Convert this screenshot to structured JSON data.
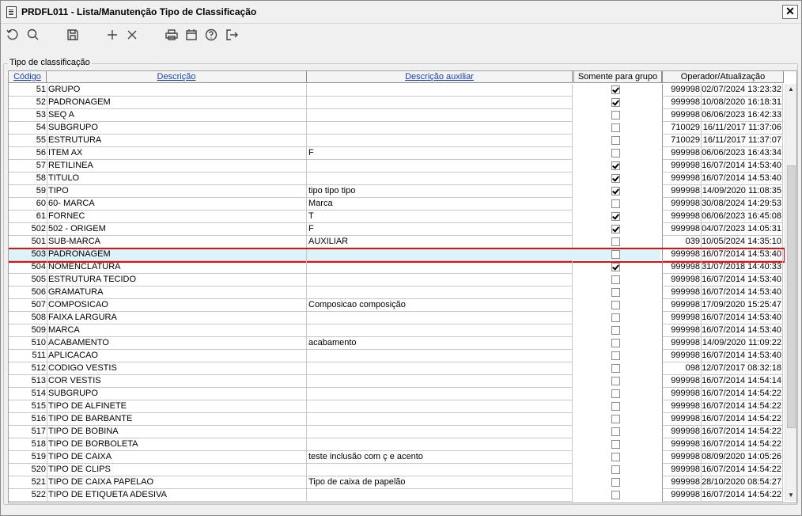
{
  "window": {
    "title": "PRDFL011 - Lista/Manutenção Tipo de Classificação",
    "close_label": "✕"
  },
  "toolbar": {
    "buttons": [
      {
        "icon": "refresh-icon",
        "label": "Atualizar"
      },
      {
        "icon": "search-icon",
        "label": "Pesquisar"
      },
      {
        "icon": "save-icon",
        "label": "Salvar"
      },
      {
        "icon": "plus-icon",
        "label": "Incluir"
      },
      {
        "icon": "close-icon",
        "label": "Excluir"
      },
      {
        "icon": "print-icon",
        "label": "Imprimir"
      },
      {
        "icon": "calendar-icon",
        "label": "Calendário"
      },
      {
        "icon": "help-icon",
        "label": "Ajuda"
      },
      {
        "icon": "exit-icon",
        "label": "Sair"
      }
    ]
  },
  "group": {
    "label": "Tipo de classificação"
  },
  "table": {
    "columns": {
      "codigo": "Código",
      "descricao": "Descrição",
      "descricao_auxiliar": "Descrição auxiliar",
      "somente_grupo": "Somente para grupo",
      "operador_atualizacao": "Operador/Atualização"
    },
    "selected_row_index": 15,
    "rows": [
      {
        "code": "51",
        "desc": "GRUPO",
        "aux": "",
        "group": true,
        "op": "999998",
        "upd": "02/07/2024 13:23:32"
      },
      {
        "code": "52",
        "desc": "PADRONAGEM",
        "aux": "",
        "group": true,
        "op": "999998",
        "upd": "10/08/2020 16:18:31"
      },
      {
        "code": "53",
        "desc": "SEQ A",
        "aux": "",
        "group": false,
        "op": "999998",
        "upd": "06/06/2023 16:42:33"
      },
      {
        "code": "54",
        "desc": "SUBGRUPO",
        "aux": "",
        "group": false,
        "op": "710029",
        "upd": "16/11/2017 11:37:06"
      },
      {
        "code": "55",
        "desc": "ESTRUTURA",
        "aux": "",
        "group": false,
        "op": "710029",
        "upd": "16/11/2017 11:37:07"
      },
      {
        "code": "56",
        "desc": "ITEM AX",
        "aux": "F",
        "group": false,
        "op": "999998",
        "upd": "06/06/2023 16:43:34"
      },
      {
        "code": "57",
        "desc": "RETILINEA",
        "aux": "",
        "group": true,
        "op": "999998",
        "upd": "16/07/2014 14:53:40"
      },
      {
        "code": "58",
        "desc": "TITULO",
        "aux": "",
        "group": true,
        "op": "999998",
        "upd": "16/07/2014 14:53:40"
      },
      {
        "code": "59",
        "desc": "TIPO",
        "aux": "tipo tipo tipo",
        "group": true,
        "op": "999998",
        "upd": "14/09/2020 11:08:35"
      },
      {
        "code": "60",
        "desc": "60- MARCA",
        "aux": "Marca",
        "group": false,
        "op": "999998",
        "upd": "30/08/2024 14:29:53"
      },
      {
        "code": "61",
        "desc": "FORNEC",
        "aux": "T",
        "group": true,
        "op": "999998",
        "upd": "06/06/2023 16:45:08"
      },
      {
        "code": "502",
        "desc": "502 - ORIGEM",
        "aux": "F",
        "group": true,
        "op": "999998",
        "upd": "04/07/2023 14:05:31"
      },
      {
        "code": "501",
        "desc": "SUB-MARCA",
        "aux": "AUXILIAR",
        "group": false,
        "op": "039",
        "upd": "10/05/2024 14:35:10"
      },
      {
        "code": "503",
        "desc": "PADRONAGEM",
        "aux": "",
        "group": false,
        "op": "999998",
        "upd": "16/07/2014 14:53:40"
      },
      {
        "code": "504",
        "desc": "NOMENCLATURA",
        "aux": "",
        "group": true,
        "op": "999998",
        "upd": "31/07/2018 14:40:33"
      },
      {
        "code": "505",
        "desc": "ESTRUTURA TECIDO",
        "aux": "",
        "group": false,
        "op": "999998",
        "upd": "16/07/2014 14:53:40"
      },
      {
        "code": "506",
        "desc": "GRAMATURA",
        "aux": "",
        "group": false,
        "op": "999998",
        "upd": "16/07/2014 14:53:40"
      },
      {
        "code": "507",
        "desc": "COMPOSICAO",
        "aux": "Composicao composição",
        "group": false,
        "op": "999998",
        "upd": "17/09/2020 15:25:47"
      },
      {
        "code": "508",
        "desc": "FAIXA LARGURA",
        "aux": "",
        "group": false,
        "op": "999998",
        "upd": "16/07/2014 14:53:40"
      },
      {
        "code": "509",
        "desc": "MARCA",
        "aux": "",
        "group": false,
        "op": "999998",
        "upd": "16/07/2014 14:53:40"
      },
      {
        "code": "510",
        "desc": "ACABAMENTO",
        "aux": "acabamento",
        "group": false,
        "op": "999998",
        "upd": "14/09/2020 11:09:22"
      },
      {
        "code": "511",
        "desc": "APLICACAO",
        "aux": "",
        "group": false,
        "op": "999998",
        "upd": "16/07/2014 14:53:40"
      },
      {
        "code": "512",
        "desc": "CODIGO VESTIS",
        "aux": "",
        "group": false,
        "op": "098",
        "upd": "12/07/2017 08:32:18"
      },
      {
        "code": "513",
        "desc": "COR VESTIS",
        "aux": "",
        "group": false,
        "op": "999998",
        "upd": "16/07/2014 14:54:14"
      },
      {
        "code": "514",
        "desc": "SUBGRUPO",
        "aux": "",
        "group": false,
        "op": "999998",
        "upd": "16/07/2014 14:54:22"
      },
      {
        "code": "515",
        "desc": "TIPO DE ALFINETE",
        "aux": "",
        "group": false,
        "op": "999998",
        "upd": "16/07/2014 14:54:22"
      },
      {
        "code": "516",
        "desc": "TIPO DE BARBANTE",
        "aux": "",
        "group": false,
        "op": "999998",
        "upd": "16/07/2014 14:54:22"
      },
      {
        "code": "517",
        "desc": "TIPO DE BOBINA",
        "aux": "",
        "group": false,
        "op": "999998",
        "upd": "16/07/2014 14:54:22"
      },
      {
        "code": "518",
        "desc": "TIPO DE BORBOLETA",
        "aux": "",
        "group": false,
        "op": "999998",
        "upd": "16/07/2014 14:54:22"
      },
      {
        "code": "519",
        "desc": "TIPO DE CAIXA",
        "aux": "teste inclusão com ç e acento",
        "group": false,
        "op": "999998",
        "upd": "08/09/2020 14:05:26"
      },
      {
        "code": "520",
        "desc": "TIPO DE CLIPS",
        "aux": "",
        "group": false,
        "op": "999998",
        "upd": "16/07/2014 14:54:22"
      },
      {
        "code": "521",
        "desc": "TIPO DE CAIXA PAPELAO",
        "aux": "Tipo de caixa de papelão",
        "group": false,
        "op": "999998",
        "upd": "28/10/2020 08:54:27"
      },
      {
        "code": "522",
        "desc": "TIPO DE ETIQUETA ADESIVA",
        "aux": "",
        "group": false,
        "op": "999998",
        "upd": "16/07/2014 14:54:22"
      }
    ]
  },
  "colors": {
    "selected_row_bg": "#dcf4f9",
    "selection_border": "#e11010",
    "header_link": "#1a3fb0"
  }
}
